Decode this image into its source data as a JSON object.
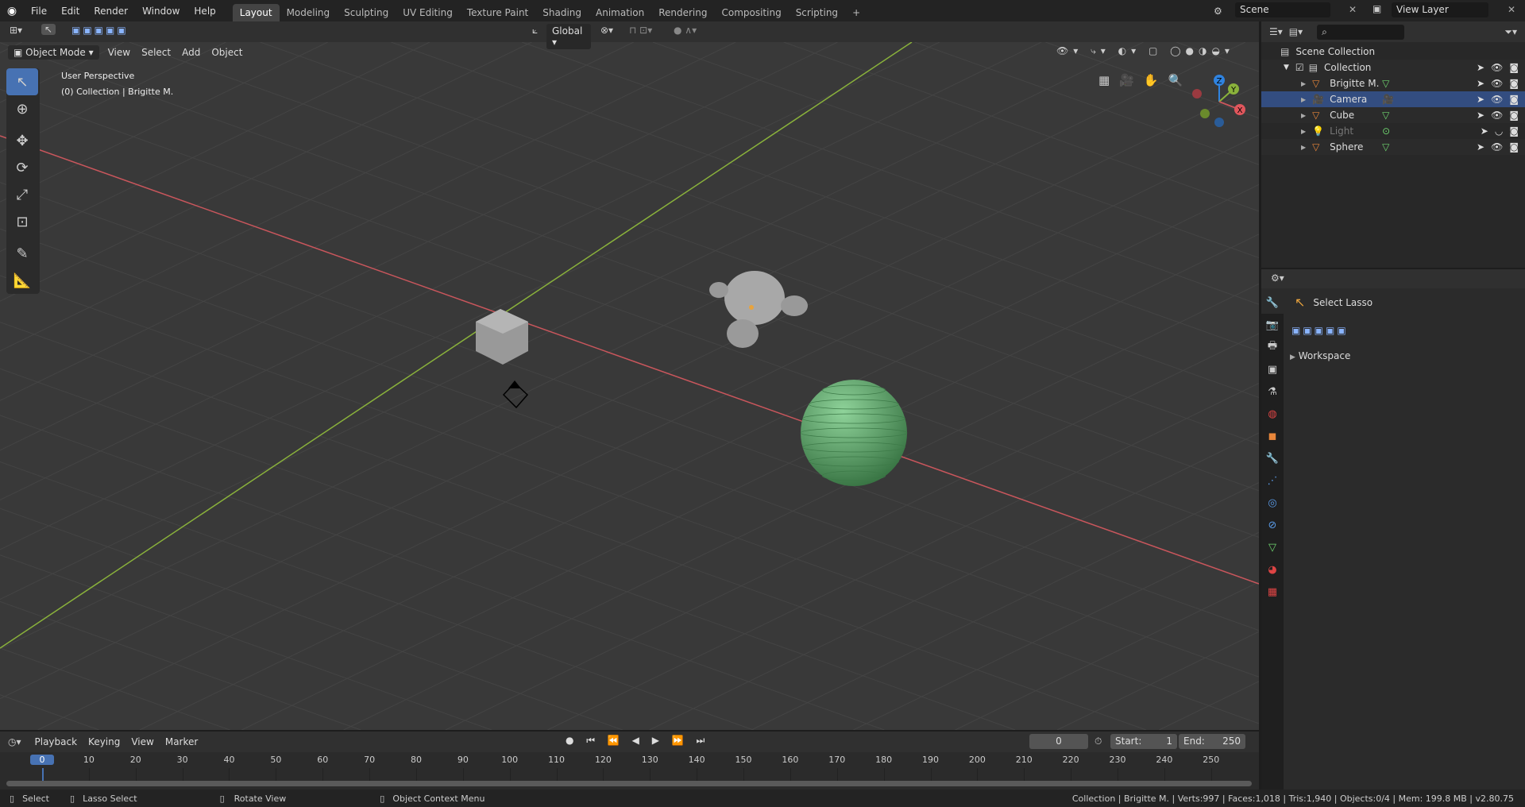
{
  "menu": [
    "File",
    "Edit",
    "Render",
    "Window",
    "Help"
  ],
  "workspaces": [
    "Layout",
    "Modeling",
    "Sculpting",
    "UV Editing",
    "Texture Paint",
    "Shading",
    "Animation",
    "Rendering",
    "Compositing",
    "Scripting"
  ],
  "add_tab": "+",
  "scene": "Scene",
  "view_layer": "View Layer",
  "viewport": {
    "mode": "Object Mode",
    "menus": [
      "View",
      "Select",
      "Add",
      "Object"
    ],
    "orientation": "Global",
    "perspective": "User Perspective",
    "context": "(0) Collection | Brigitte M.",
    "gizmo": {
      "x": "X",
      "y": "Y",
      "z": "Z"
    }
  },
  "outliner": {
    "root": "Scene Collection",
    "collection": "Collection",
    "items": [
      {
        "name": "Brigitte M.",
        "type": "mesh",
        "selected": false
      },
      {
        "name": "Camera",
        "type": "camera",
        "selected": true
      },
      {
        "name": "Cube",
        "type": "mesh",
        "selected": false
      },
      {
        "name": "Light",
        "type": "light",
        "selected": false,
        "hidden": true
      },
      {
        "name": "Sphere",
        "type": "mesh",
        "selected": false
      }
    ],
    "search_placeholder": ""
  },
  "properties": {
    "tool_name": "Select Lasso",
    "section": "Workspace"
  },
  "timeline": {
    "menus": [
      "Playback",
      "Keying",
      "View",
      "Marker"
    ],
    "current_frame": "0",
    "start_label": "Start:",
    "start": "1",
    "end_label": "End:",
    "end": "250",
    "ticks": [
      "0",
      "10",
      "20",
      "30",
      "40",
      "50",
      "60",
      "70",
      "80",
      "90",
      "100",
      "110",
      "120",
      "130",
      "140",
      "150",
      "160",
      "170",
      "180",
      "190",
      "200",
      "210",
      "220",
      "230",
      "240",
      "250"
    ]
  },
  "status": {
    "select": "Select",
    "lasso": "Lasso Select",
    "rotate": "Rotate View",
    "context_menu": "Object Context Menu",
    "info": "Collection | Brigitte M. | Verts:997 | Faces:1,018 | Tris:1,940 | Objects:0/4 | Mem: 199.8 MB | v2.80.75"
  },
  "colors": {
    "accent": "#4772b3",
    "x_axis": "#c9565c",
    "y_axis": "#8ab23b",
    "sphere": "#5aa86a",
    "selected_row": "#334d80"
  }
}
